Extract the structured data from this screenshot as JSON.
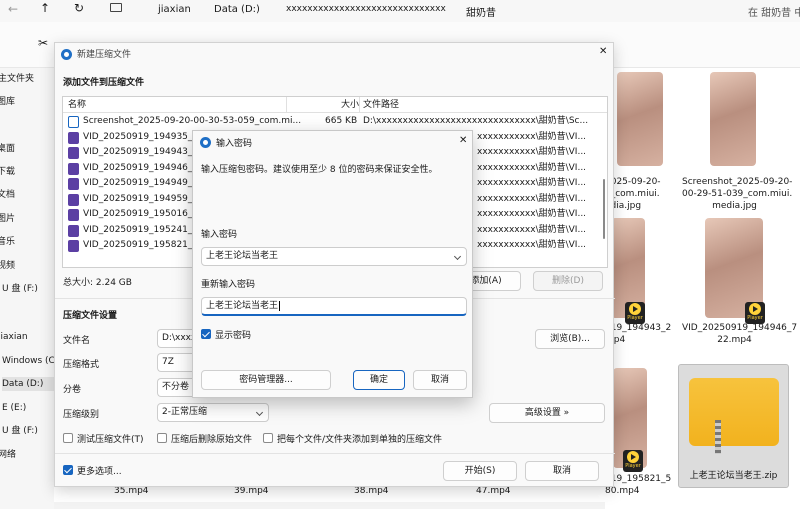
{
  "explorer": {
    "breadcrumbs": [
      "jiaxian",
      "Data (D:)",
      "xxxxxxxxxxxxxxxxxxxxxxxxxxxxxx",
      "甜奶昔"
    ],
    "search_placeholder": "在 甜奶昔 中",
    "sidebar": [
      "主文件夹",
      "图库",
      "桌面",
      "下载",
      "文档",
      "图片",
      "音乐",
      "视频",
      "U 盘 (F:)",
      "jiaxian",
      "Windows (C:)",
      "Data (D:)",
      "E (E:)",
      "U 盘 (F:)",
      "网络"
    ],
    "files": [
      {
        "name": "2025-09-20-\n1_com.miui.\nedia.jpg"
      },
      {
        "name": "Screenshot_2025-09-20-\n00-29-51-039_com.miui.\nmedia.jpg"
      },
      {
        "name": "919_194943_2\nmp4"
      },
      {
        "name": "VID_20250919_194946_7\n22.mp4"
      },
      {
        "name": "919_195821_5\n80.mp4"
      },
      {
        "name": "上老王论坛当老王.zip"
      }
    ],
    "bottom_names": [
      "35.mp4",
      "39.mp4",
      "38.mp4",
      "47.mp4"
    ],
    "player_label": "Player"
  },
  "archive_dialog": {
    "title": "新建压缩文件",
    "section_add": "添加文件到压缩文件",
    "col_name": "名称",
    "col_size": "大小",
    "col_path": "文件路径",
    "rows": [
      {
        "name": "Screenshot_2025-09-20-00-30-53-059_com.mi...",
        "size": "665 KB",
        "path": "D:\\xxxxxxxxxxxxxxxxxxxxxxxxxxxxxx\\甜奶昔\\Sc..."
      },
      {
        "name": "VID_20250919_194935_680",
        "size": "",
        "path": "xxxxxxxxxxx\\甜奶昔\\VI..."
      },
      {
        "name": "VID_20250919_194943_209",
        "size": "",
        "path": "xxxxxxxxxxx\\甜奶昔\\VI..."
      },
      {
        "name": "VID_20250919_194946_722",
        "size": "",
        "path": "xxxxxxxxxxx\\甜奶昔\\VI..."
      },
      {
        "name": "VID_20250919_194949_835",
        "size": "",
        "path": "xxxxxxxxxxx\\甜奶昔\\VI..."
      },
      {
        "name": "VID_20250919_194959_339",
        "size": "",
        "path": "xxxxxxxxxxx\\甜奶昔\\VI..."
      },
      {
        "name": "VID_20250919_195016_038",
        "size": "",
        "path": "xxxxxxxxxxx\\甜奶昔\\VI..."
      },
      {
        "name": "VID_20250919_195241_247",
        "size": "",
        "path": "xxxxxxxxxxx\\甜奶昔\\VI..."
      },
      {
        "name": "VID_20250919_195821_580",
        "size": "",
        "path": "xxxxxxxxxxx\\甜奶昔\\VI..."
      }
    ],
    "total_size": "总大小: 2.24 GB",
    "add_btn": "添加(A)",
    "delete_btn": "删除(D)",
    "settings_title": "压缩文件设置",
    "filename_label": "文件名",
    "filename_value": "D:\\xxxx",
    "browse_btn": "浏览(B)...",
    "format_label": "压缩格式",
    "format_value": "7Z",
    "split_label": "分卷",
    "split_value": "不分卷",
    "level_label": "压缩级别",
    "level_value": "2-正常压缩",
    "advanced_btn": "高级设置 »",
    "test_label": "测试压缩文件(T)",
    "delete_after_label": "压缩后删除原始文件",
    "each_file_label": "把每个文件/文件夹添加到单独的压缩文件",
    "more_options": "更多选项...",
    "start_btn": "开始(S)",
    "cancel_btn": "取消"
  },
  "password_dialog": {
    "title": "输入密码",
    "hint": "输入压缩包密码。建议使用至少 8 位的密码来保证安全性。",
    "enter_label": "输入密码",
    "enter_value": "上老王论坛当老王",
    "reenter_label": "重新输入密码",
    "reenter_value": "上老王论坛当老王",
    "show_label": "显示密码",
    "manager_btn": "密码管理器...",
    "ok_btn": "确定",
    "cancel_btn": "取消"
  },
  "colors": {
    "accent": "#1765c0",
    "video_icon": "#5b3fa3"
  }
}
